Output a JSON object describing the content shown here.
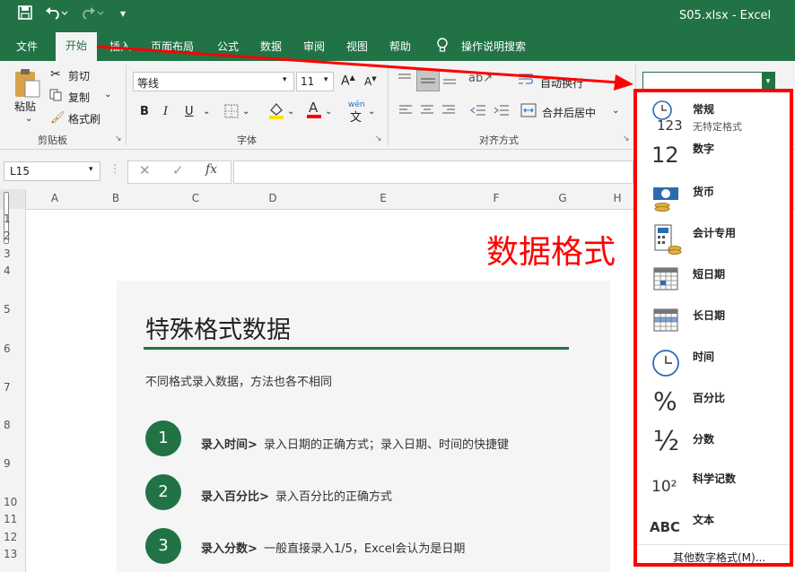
{
  "window": {
    "title": "S05.xlsx  -  Excel"
  },
  "ribbon_tabs": [
    "文件",
    "开始",
    "插入",
    "页面布局",
    "公式",
    "数据",
    "审阅",
    "视图",
    "帮助"
  ],
  "tell_me": "操作说明搜索",
  "clipboard": {
    "paste": "粘贴",
    "cut": "剪切",
    "copy": "复制",
    "format_painter": "格式刷",
    "group": "剪贴板"
  },
  "font": {
    "name": "等线",
    "size": "11",
    "group": "字体",
    "bold": "B",
    "italic": "I",
    "underline": "U",
    "phonetic": "wén"
  },
  "alignment": {
    "wrap_text": "自动换行",
    "merge_center": "合并后居中",
    "group": "对齐方式"
  },
  "formula_bar": {
    "name_box": "L15",
    "fx": "fx",
    "value": ""
  },
  "columns": [
    "A",
    "B",
    "C",
    "D",
    "E",
    "F",
    "G",
    "H"
  ],
  "rows": [
    "1",
    "2",
    "3",
    "4",
    "5",
    "6",
    "7",
    "8",
    "9",
    "10",
    "11",
    "12",
    "13"
  ],
  "annotation": "数据格式",
  "card": {
    "title": "特殊格式数据",
    "subtitle": "不同格式录入数据，方法也各不相同",
    "items": [
      {
        "num": "1",
        "bold": "录入时间>",
        "text": " 录入日期的正确方式；录入日期、时间的快捷键"
      },
      {
        "num": "2",
        "bold": "录入百分比>",
        "text": " 录入百分比的正确方式"
      },
      {
        "num": "3",
        "bold": "录入分数>",
        "text": " 一般直接录入1/5，Excel会认为是日期"
      }
    ]
  },
  "number_format_menu": {
    "items": [
      {
        "icon": "clock-123-icon",
        "label": "常规",
        "sub": "无特定格式"
      },
      {
        "icon": "number-12-icon",
        "label": "数字"
      },
      {
        "icon": "currency-icon",
        "label": "货币"
      },
      {
        "icon": "accounting-icon",
        "label": "会计专用"
      },
      {
        "icon": "short-date-icon",
        "label": "短日期"
      },
      {
        "icon": "long-date-icon",
        "label": "长日期"
      },
      {
        "icon": "clock-icon",
        "label": "时间"
      },
      {
        "icon": "percent-icon",
        "label": "百分比"
      },
      {
        "icon": "fraction-icon",
        "label": "分数"
      },
      {
        "icon": "scientific-icon",
        "label": "科学记数"
      },
      {
        "icon": "text-abc-icon",
        "label": "文本"
      }
    ],
    "more": "其他数字格式(M)...",
    "icon_glyphs": {
      "number": "12",
      "percent": "%",
      "fraction": "½",
      "sci": "10²",
      "abc": "ABC",
      "c123": "123"
    }
  },
  "colors": {
    "excel_green": "#217346",
    "annotation_red": "#ff0000"
  }
}
